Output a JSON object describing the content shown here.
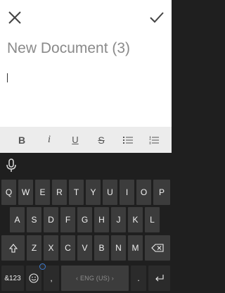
{
  "document": {
    "title": "New Document (3)"
  },
  "header": {
    "close_icon": "close-icon",
    "confirm_icon": "checkmark-icon"
  },
  "format_toolbar": {
    "bold": "B",
    "italic": "i",
    "underline": "U",
    "strikethrough": "S",
    "bullets_icon": "bulleted-list-icon",
    "numbers_icon": "numbered-list-icon"
  },
  "keyboard": {
    "mic_icon": "microphone-icon",
    "row1": [
      "Q",
      "W",
      "E",
      "R",
      "T",
      "Y",
      "U",
      "I",
      "O",
      "P"
    ],
    "row2": [
      "A",
      "S",
      "D",
      "F",
      "G",
      "H",
      "J",
      "K",
      "L"
    ],
    "row3": [
      "Z",
      "X",
      "C",
      "V",
      "B",
      "N",
      "M"
    ],
    "shift_icon": "shift-arrow-icon",
    "backspace_icon": "backspace-icon",
    "symbols_label": "&123",
    "emoji_icon": "emoji-icon",
    "comma_label": ",",
    "space_label": "‹ ENG (US) ›",
    "period_label": ".",
    "enter_icon": "enter-icon"
  },
  "colors": {
    "keyboard_bg": "#1f1f1f",
    "key_bg": "#3c3c3c",
    "toolbar_bg": "#ececec",
    "accent": "#3d7bd1"
  }
}
